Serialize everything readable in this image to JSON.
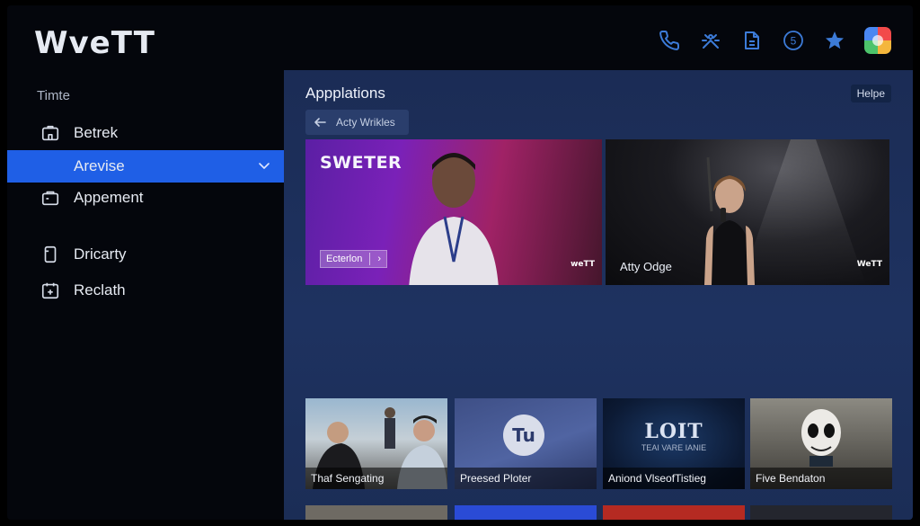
{
  "header": {
    "logo": "WveTT",
    "icons": [
      "phone-icon",
      "broadcast-icon",
      "document-icon",
      "badge-5-icon",
      "star-icon",
      "app-tile-icon"
    ],
    "badge_number": "5",
    "accent_color": "#3c7bd8"
  },
  "sidebar": {
    "section_label": "Timte",
    "items": [
      {
        "label": "Betrek",
        "icon": "briefcase-icon"
      },
      {
        "label": "Arevise",
        "icon": "chevron-down-icon",
        "active": true
      },
      {
        "label": "Appement",
        "icon": "folder-icon"
      },
      {
        "label": "Dricarty",
        "icon": "phone-device-icon"
      },
      {
        "label": "Reclath",
        "icon": "calendar-icon"
      }
    ],
    "active_color": "#1f5fe6"
  },
  "main": {
    "title": "Appplations",
    "help_label": "Helpe",
    "back_label": "Acty Wrikles",
    "heroes": [
      {
        "brand": "SWETER",
        "pill_label": "Ecterlon",
        "watermark": "weTT"
      },
      {
        "caption": "Atty Odge",
        "watermark": "WeTT"
      }
    ],
    "thumbnails": [
      {
        "caption": "Thaf Sengating"
      },
      {
        "caption": "Preesed Ploter",
        "logo_text": "Tu"
      },
      {
        "caption": "Aniond VlseofTistieg",
        "title": "LOIT",
        "subtitle": "TEAI VARE IANIE"
      },
      {
        "caption": "Five Bendaton"
      }
    ]
  }
}
